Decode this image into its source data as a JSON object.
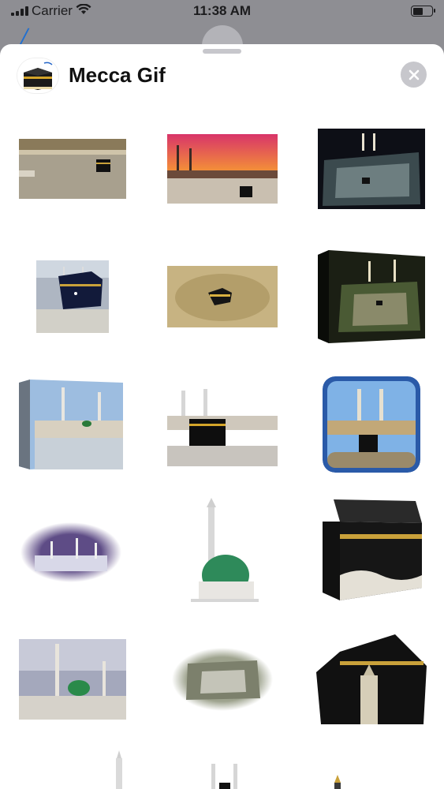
{
  "status_bar": {
    "carrier": "Carrier",
    "time": "11:38 AM"
  },
  "sheet": {
    "title": "Mecca Gif",
    "close_icon": "close-icon",
    "app_icon": "kaaba-icon"
  },
  "stickers": [
    "sticker-grand-mosque-crowd",
    "sticker-mosque-sunset",
    "sticker-mosque-night-aerial",
    "sticker-kaaba-closeup",
    "sticker-kaaba-aerial-day",
    "sticker-mosque-night-canvas",
    "sticker-prophets-mosque-reflection",
    "sticker-kaaba-minarets",
    "sticker-kaaba-framed",
    "sticker-mosque-oval-night",
    "sticker-green-dome",
    "sticker-kaaba-cube",
    "sticker-prophets-mosque-day",
    "sticker-mosque-oval-aerial",
    "sticker-kaaba-clock-tower",
    "sticker-minaret",
    "sticker-minarets-kaaba",
    "sticker-spire"
  ]
}
